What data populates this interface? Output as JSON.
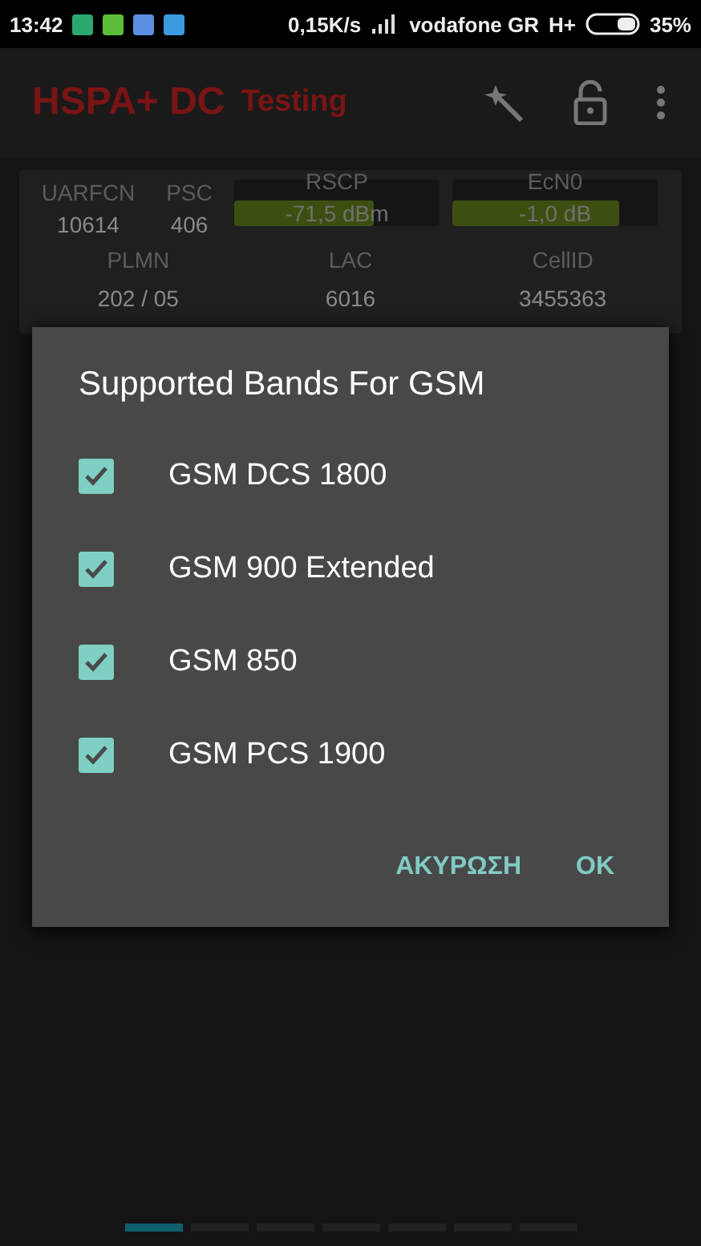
{
  "status_bar": {
    "time": "13:42",
    "speed": "0,15K/s",
    "carrier": "vodafone GR",
    "network": "H+",
    "battery": "35%"
  },
  "app_bar": {
    "title": "HSPA+ DC",
    "subtitle": "Testing"
  },
  "cells": [
    {
      "label": "UARFCN",
      "value": "10614",
      "kind": "text"
    },
    {
      "label": "PSC",
      "value": "406",
      "kind": "text"
    },
    {
      "label": "RSCP",
      "value": "-71,5 dBm",
      "kind": "meter",
      "level": 0.68
    },
    {
      "label": "EcN0",
      "value": "-1,0 dB",
      "kind": "meter",
      "level": 0.81
    }
  ],
  "cells_2": [
    {
      "label": "PLMN",
      "value": "202 / 05"
    },
    {
      "label": "LAC",
      "value": "6016"
    },
    {
      "label": "CellID",
      "value": "3455363"
    }
  ],
  "dialog": {
    "title": "Supported Bands For GSM",
    "options": [
      {
        "label": "GSM DCS 1800",
        "checked": true
      },
      {
        "label": "GSM 900 Extended",
        "checked": true
      },
      {
        "label": "GSM 850",
        "checked": true
      },
      {
        "label": "GSM PCS 1900",
        "checked": true
      }
    ],
    "buttons": [
      "ΑΚΥΡΩΣΗ",
      "OK"
    ]
  },
  "pages": [
    {
      "selected": true
    },
    {
      "selected": false
    },
    {
      "selected": false
    },
    {
      "selected": false
    },
    {
      "selected": false
    },
    {
      "selected": false
    },
    {
      "selected": false
    }
  ]
}
